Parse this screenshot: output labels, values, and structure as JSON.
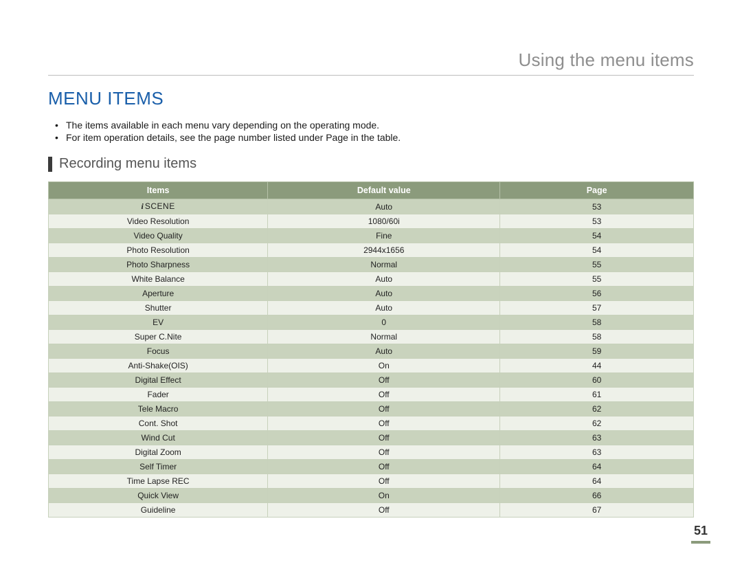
{
  "chapter_title": "Using the menu items",
  "section_title": "MENU ITEMS",
  "notes": [
    "The items available in each menu vary depending on the operating mode.",
    "For item operation details, see the page number listed under Page in the table."
  ],
  "subsection_title": "Recording menu items",
  "table": {
    "headers": {
      "items": "Items",
      "default": "Default value",
      "page": "Page"
    },
    "rows": [
      {
        "item": "SCENE",
        "item_prefix_icon": "i",
        "small_caps": true,
        "default": "Auto",
        "page": "53"
      },
      {
        "item": "Video Resolution",
        "default": "1080/60i",
        "page": "53"
      },
      {
        "item": "Video Quality",
        "default": "Fine",
        "page": "54"
      },
      {
        "item": "Photo Resolution",
        "default": "2944x1656",
        "page": "54"
      },
      {
        "item": "Photo Sharpness",
        "default": "Normal",
        "page": "55"
      },
      {
        "item": "White Balance",
        "default": "Auto",
        "page": "55"
      },
      {
        "item": "Aperture",
        "default": "Auto",
        "page": "56"
      },
      {
        "item": "Shutter",
        "default": "Auto",
        "page": "57"
      },
      {
        "item": "EV",
        "default": "0",
        "page": "58"
      },
      {
        "item": "Super C.Nite",
        "default": "Normal",
        "page": "58"
      },
      {
        "item": "Focus",
        "default": "Auto",
        "page": "59"
      },
      {
        "item": "Anti-Shake(OIS)",
        "default": "On",
        "page": "44"
      },
      {
        "item": "Digital Effect",
        "default": "Off",
        "page": "60"
      },
      {
        "item": "Fader",
        "default": "Off",
        "page": "61"
      },
      {
        "item": "Tele Macro",
        "default": "Off",
        "page": "62"
      },
      {
        "item": "Cont. Shot",
        "default": "Off",
        "page": "62"
      },
      {
        "item": "Wind Cut",
        "default": "Off",
        "page": "63"
      },
      {
        "item": "Digital Zoom",
        "default": "Off",
        "page": "63"
      },
      {
        "item": "Self Timer",
        "default": "Off",
        "page": "64"
      },
      {
        "item": "Time Lapse REC",
        "default": "Off",
        "page": "64"
      },
      {
        "item": "Quick View",
        "default": "On",
        "page": "66"
      },
      {
        "item": "Guideline",
        "default": "Off",
        "page": "67"
      }
    ]
  },
  "page_number": "51"
}
